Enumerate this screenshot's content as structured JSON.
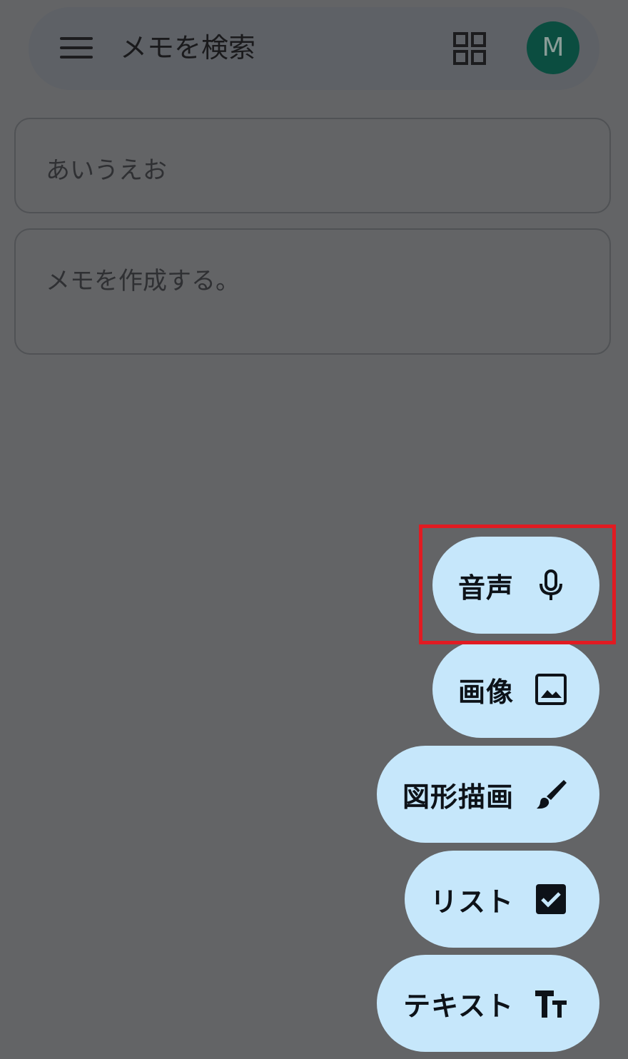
{
  "search_bar": {
    "placeholder": "メモを検索",
    "avatar_initial": "M"
  },
  "notes": [
    {
      "text": "あいうえお"
    },
    {
      "text": "メモを作成する。"
    }
  ],
  "fab_menu": {
    "items": [
      {
        "label": "音声",
        "icon": "microphone-icon"
      },
      {
        "label": "画像",
        "icon": "image-icon"
      },
      {
        "label": "図形描画",
        "icon": "brush-icon"
      },
      {
        "label": "リスト",
        "icon": "checkbox-icon"
      },
      {
        "label": "テキスト",
        "icon": "text-format-icon"
      }
    ]
  },
  "colors": {
    "scrim": "#636466",
    "fab_background": "#c6e7fb",
    "avatar_background": "#0b4d40",
    "highlight": "#e11b22"
  }
}
